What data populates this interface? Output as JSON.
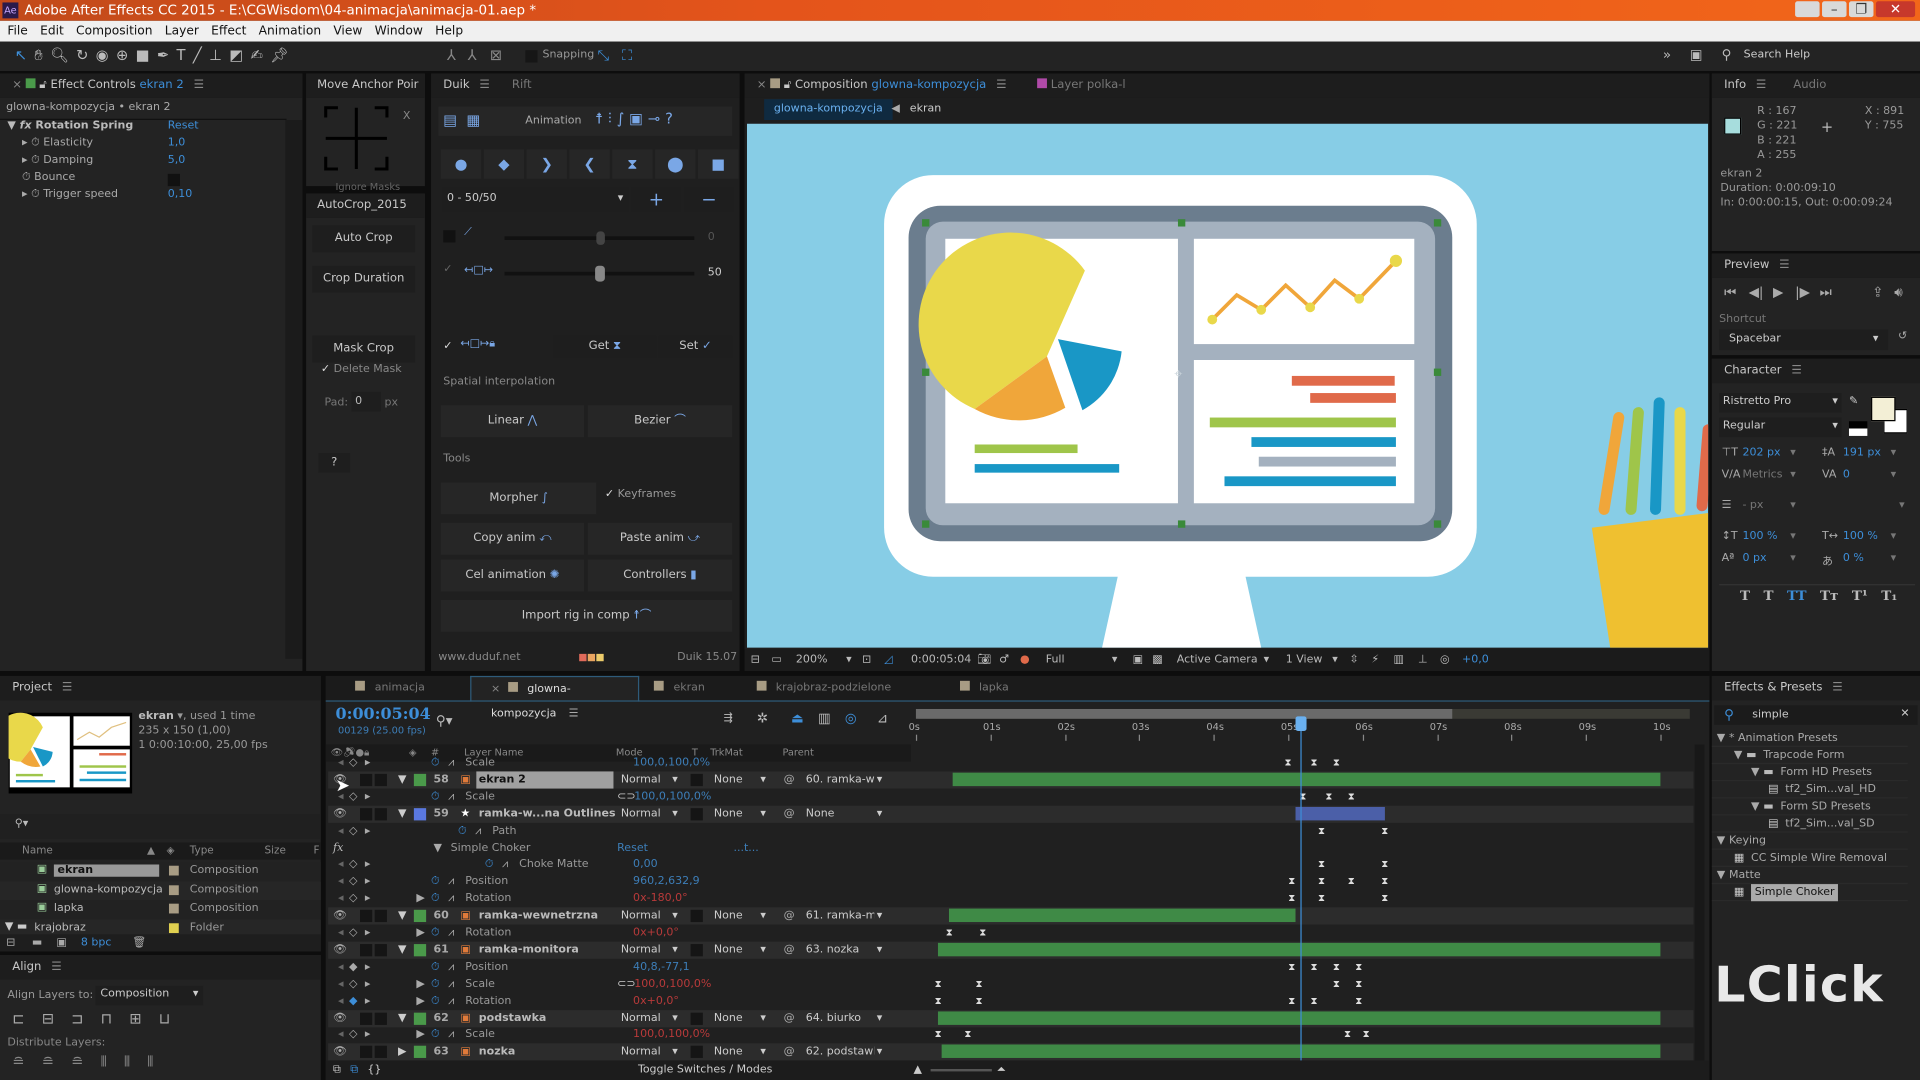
{
  "app": {
    "title": "Adobe After Effects CC 2015 - E:\\CGWisdom\\04-animacja\\animacja-01.aep *",
    "logo": "Ae",
    "window_buttons": [
      "minimize",
      "restore",
      "close"
    ]
  },
  "menu": [
    "File",
    "Edit",
    "Composition",
    "Layer",
    "Effect",
    "Animation",
    "View",
    "Window",
    "Help"
  ],
  "toolbar": {
    "tools": [
      "selection-tool",
      "hand-tool",
      "zoom-tool",
      "rotate-tool",
      "orbit-camera-tool",
      "pan-behind-tool",
      "rectangle-tool",
      "pen-tool",
      "type-tool",
      "brush-tool",
      "clone-stamp-tool",
      "eraser-tool",
      "roto-brush-tool",
      "puppet-pin-tool"
    ],
    "snapping": "Snapping",
    "search_help": "Search Help"
  },
  "effect_controls": {
    "tab": "Effect Controls",
    "layer": "ekran 2",
    "breadcrumb": "glowna-kompozycja • ekran 2",
    "effect": "Rotation Spring",
    "reset": "Reset",
    "params": [
      {
        "name": "Elasticity",
        "value": "1,0"
      },
      {
        "name": "Damping",
        "value": "5,0"
      },
      {
        "name": "Bounce",
        "value": ""
      },
      {
        "name": "Trigger speed",
        "value": "0,10"
      }
    ]
  },
  "move_anchor": {
    "tab": "Move Anchor Poir",
    "x": "X",
    "ignore_masks": "Ignore Masks"
  },
  "autocrop": {
    "tab": "AutoCrop_2015",
    "auto_crop": "Auto Crop",
    "crop_duration": "Crop Duration",
    "mask_crop": "Mask Crop",
    "delete_mask": "Delete Mask",
    "pad_label": "Pad:",
    "pad_value": "0",
    "pad_unit": "px",
    "help": "?"
  },
  "duik": {
    "tabs": [
      "Duik",
      "Rift"
    ],
    "section": "Animation",
    "preset": "0 - 50/50",
    "slider1_value": "0",
    "slider1_level": 50,
    "slider2_value": "50",
    "slider2_level": 50,
    "get": "Get",
    "set": "Set",
    "spatial": "Spatial interpolation",
    "linear": "Linear",
    "bezier": "Bezier",
    "tools": "Tools",
    "morpher": "Morpher",
    "keyframes": "Keyframes",
    "copy_anim": "Copy anim",
    "paste_anim": "Paste anim",
    "cel_animation": "Cel animation",
    "controllers": "Controllers",
    "import_rig": "Import rig in comp",
    "website": "www.duduf.net",
    "version": "Duik 15.07"
  },
  "composition": {
    "tab_label": "Composition",
    "comp_name": "glowna-kompozycja",
    "other_tab": "Layer polka-l",
    "nav": [
      "glowna-kompozycja",
      "ekran"
    ],
    "zoom": "200%",
    "time": "0:00:05:04",
    "resolution": "Full",
    "camera": "Active Camera",
    "views": "1 View",
    "exposure": "+0,0",
    "bg": "#87cde6"
  },
  "info": {
    "tabs": [
      "Info",
      "Audio"
    ],
    "r": "R : 167",
    "g": "G : 221",
    "b": "B : 221",
    "a": "A : 255",
    "x": "X : 891",
    "y": "Y : 755",
    "swatch": "#a7dddd",
    "layer": "ekran 2",
    "duration": "Duration: 0:00:09:10",
    "inout": "In: 0:00:00:15, Out: 0:00:09:24"
  },
  "preview": {
    "tab": "Preview",
    "shortcut_label": "Shortcut",
    "shortcut": "Spacebar"
  },
  "character": {
    "tab": "Character",
    "font": "Ristretto Pro",
    "style": "Regular",
    "size": "202 px",
    "leading": "191 px",
    "kerning": "Metrics",
    "tracking": "0",
    "stroke": "- px",
    "vscale": "100 %",
    "hscale": "100 %",
    "baseline": "0 px",
    "tsume": "0 %",
    "fill": "#f3efd6",
    "styles": [
      "T",
      "T",
      "TT",
      "Tт",
      "T¹",
      "T₁"
    ]
  },
  "project": {
    "tab": "Project",
    "selected": "ekran",
    "used": ", used 1 time",
    "dims": "235 x 150 (1,00)",
    "duration": "1 0:00:10:00, 25,00 fps",
    "cols": [
      "Name",
      "Type",
      "Size",
      "F"
    ],
    "items": [
      {
        "name": "ekran",
        "type": "Composition",
        "kind": "comp",
        "color": "#a89c84"
      },
      {
        "name": "glowna-kompozycja",
        "type": "Composition",
        "kind": "comp",
        "color": "#a89c84"
      },
      {
        "name": "lapka",
        "type": "Composition",
        "kind": "comp",
        "color": "#a89c84"
      },
      {
        "name": "krajobraz",
        "type": "Folder",
        "kind": "folder",
        "color": "#e0d050"
      }
    ],
    "bpc": "8 bpc"
  },
  "align": {
    "tab": "Align",
    "align_to_label": "Align Layers to:",
    "align_to": "Composition",
    "distribute": "Distribute Layers:"
  },
  "timeline": {
    "tabs": [
      "animacja",
      "glowna-kompozycja",
      "ekran",
      "krajobraz-podzielone",
      "lapka"
    ],
    "active_tab": 1,
    "time": "0:00:05:04",
    "frames": "00129 (25.00 fps)",
    "cols": [
      "#",
      "Layer Name",
      "Mode",
      "T",
      "TrkMat",
      "Parent"
    ],
    "ruler": [
      "0s",
      "01s",
      "02s",
      "03s",
      "04s",
      "05s",
      "06s",
      "07s",
      "08s",
      "09s",
      "10s"
    ],
    "playhead_s": 5.16,
    "work_area": [
      0,
      7.2
    ],
    "toggle": "Toggle Switches / Modes",
    "rows": [
      {
        "kind": "prop",
        "indent": 2,
        "name": "Scale",
        "value": "100,0,100,0%",
        "vc": "blue",
        "kf": [
          5.0,
          5.35,
          5.65
        ]
      },
      {
        "kind": "layer",
        "num": "58",
        "name": "ekran 2",
        "selected": true,
        "label": "#4a9a4a",
        "mode": "Normal",
        "trk": "None",
        "parent": "60. ramka-we",
        "bar": [
          0.5,
          10
        ],
        "barc": "#3f8a46"
      },
      {
        "kind": "prop",
        "indent": 2,
        "name": "Scale",
        "value": "100,0,100,0%",
        "vc": "blue",
        "link": true,
        "kf": [
          5.2,
          5.55,
          5.85
        ]
      },
      {
        "kind": "layer",
        "num": "59",
        "name": "ramka-w...na Outlines",
        "star": true,
        "label": "#5a78e0",
        "mode": "Normal",
        "trk": "None",
        "parent": "None",
        "bar": [
          5.1,
          6.3
        ],
        "barc": "#4b5fa8"
      },
      {
        "kind": "prop",
        "indent": 3,
        "name": "Path",
        "value": "",
        "vc": "blue",
        "kf": [
          5.45,
          6.3
        ]
      },
      {
        "kind": "effect",
        "name": "Simple Choker",
        "value": "Reset",
        "extra": "...t..."
      },
      {
        "kind": "prop",
        "indent": 4,
        "name": "Choke Matte",
        "value": "0,00",
        "vc": "blue",
        "kf": [
          5.45,
          6.3
        ]
      },
      {
        "kind": "prop",
        "indent": 2,
        "name": "Position",
        "value": "960,2,632,9",
        "vc": "blue",
        "kf": [
          5.05,
          5.45,
          5.85,
          6.3
        ]
      },
      {
        "kind": "prop",
        "indent": 2,
        "name": "Rotation",
        "value": "0x-180,0°",
        "vc": "red",
        "tw": true,
        "kf": [
          5.05,
          5.45,
          6.3
        ]
      },
      {
        "kind": "layer",
        "num": "60",
        "name": "ramka-wewnetrzna",
        "label": "#4a9a4a",
        "mode": "Normal",
        "trk": "None",
        "parent": "61. ramka-mc",
        "bar": [
          0.45,
          5.1
        ],
        "barc": "#3f8a46"
      },
      {
        "kind": "prop",
        "indent": 2,
        "name": "Rotation",
        "value": "0x+0,0°",
        "vc": "red",
        "tw": true,
        "kf": [
          0.45,
          0.9
        ]
      },
      {
        "kind": "layer",
        "num": "61",
        "name": "ramka-monitora",
        "label": "#4a9a4a",
        "mode": "Normal",
        "trk": "None",
        "parent": "63. nozka",
        "bar": [
          0.3,
          10
        ],
        "barc": "#3f8a46"
      },
      {
        "kind": "prop",
        "indent": 2,
        "name": "Position",
        "value": "40,8,-77,1",
        "vc": "blue",
        "kf": [
          5.05,
          5.35,
          5.65,
          5.95
        ]
      },
      {
        "kind": "prop",
        "indent": 2,
        "name": "Scale",
        "value": "100,0,100,0%",
        "vc": "red",
        "link": true,
        "tw": true,
        "kf": [
          0.3,
          0.85,
          5.65,
          5.95
        ]
      },
      {
        "kind": "prop",
        "indent": 2,
        "name": "Rotation",
        "value": "0x+0,0°",
        "vc": "red",
        "tw": true,
        "kf": [
          0.3,
          0.85,
          5.05,
          5.35,
          5.95
        ]
      },
      {
        "kind": "layer",
        "num": "62",
        "name": "podstawka",
        "label": "#4a9a4a",
        "mode": "Normal",
        "trk": "None",
        "parent": "64. biurko",
        "bar": [
          0.3,
          10
        ],
        "barc": "#3f8a46"
      },
      {
        "kind": "prop",
        "indent": 2,
        "name": "Scale",
        "value": "100,0,100,0%",
        "vc": "red",
        "tw": true,
        "kf": [
          0.3,
          0.7,
          5.8,
          6.05
        ]
      },
      {
        "kind": "layer",
        "num": "63",
        "name": "nozka",
        "collapsed": true,
        "label": "#4a9a4a",
        "mode": "Normal",
        "trk": "None",
        "parent": "62. podstawk",
        "bar": [
          0.35,
          10
        ],
        "barc": "#3f8a46"
      }
    ]
  },
  "effects_presets": {
    "tab": "Effects & Presets",
    "search": "simple",
    "tree": [
      {
        "d": 0,
        "t": "▼",
        "label": "* Animation Presets"
      },
      {
        "d": 1,
        "t": "▼",
        "label": "Trapcode Form",
        "icon": "folder"
      },
      {
        "d": 2,
        "t": "▼",
        "label": "Form HD Presets",
        "icon": "folder"
      },
      {
        "d": 3,
        "t": "",
        "label": "tf2_Sim...val_HD",
        "icon": "preset"
      },
      {
        "d": 2,
        "t": "▼",
        "label": "Form SD Presets",
        "icon": "folder"
      },
      {
        "d": 3,
        "t": "",
        "label": "tf2_Sim...val_SD",
        "icon": "preset"
      },
      {
        "d": 0,
        "t": "▼",
        "label": "Keying"
      },
      {
        "d": 1,
        "t": "",
        "label": "CC Simple Wire Removal",
        "icon": "effect"
      },
      {
        "d": 0,
        "t": "▼",
        "label": "Matte"
      },
      {
        "d": 1,
        "t": "",
        "label": "Simple Choker",
        "icon": "effect",
        "selected": true
      }
    ]
  },
  "watermark": "LClick"
}
